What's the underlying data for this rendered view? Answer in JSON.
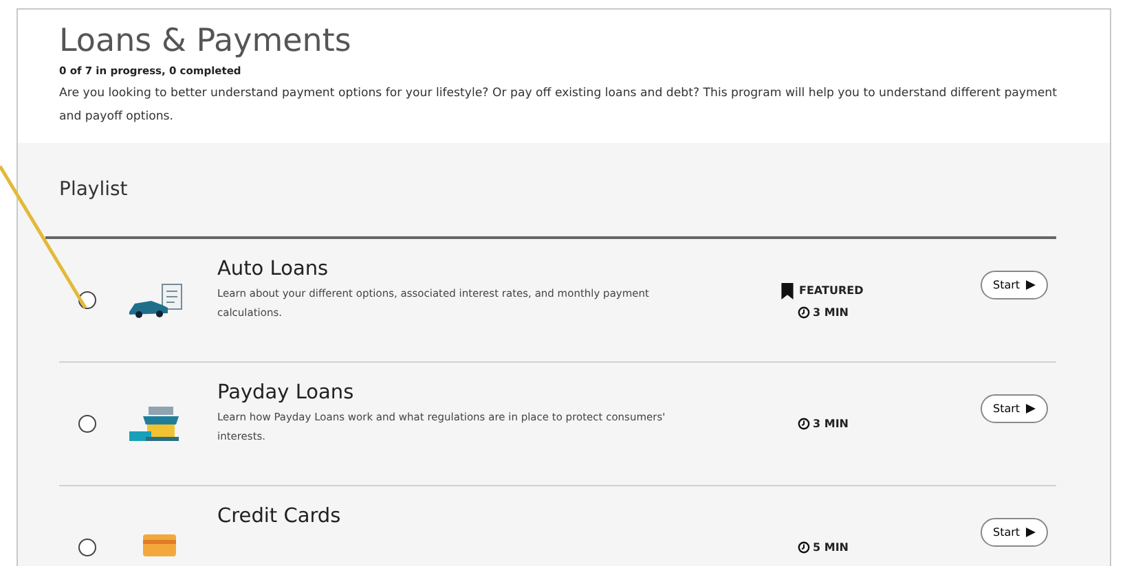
{
  "header": {
    "title": "Loans & Payments",
    "progress": "0 of 7 in progress, 0 completed",
    "description": "Are you looking to better understand payment options for your lifestyle? Or pay off existing loans and debt? This program will help you to understand different payment and payoff options."
  },
  "playlist": {
    "title": "Playlist",
    "items": [
      {
        "title": "Auto Loans",
        "description": "Learn about your different options, associated interest rates, and monthly payment calculations.",
        "featured": true,
        "featured_label": "FEATURED",
        "duration": "3 MIN",
        "button": "Start",
        "selected": false,
        "kind": "car"
      },
      {
        "title": "Payday Loans",
        "description": "Learn how Payday Loans work and what regulations are in place to protect consumers' interests.",
        "featured": false,
        "duration": "3 MIN",
        "button": "Start",
        "selected": false,
        "kind": "store"
      },
      {
        "title": "Credit Cards",
        "featured": false,
        "duration": "5 MIN",
        "button": "Start",
        "selected": false,
        "kind": "card"
      }
    ]
  }
}
